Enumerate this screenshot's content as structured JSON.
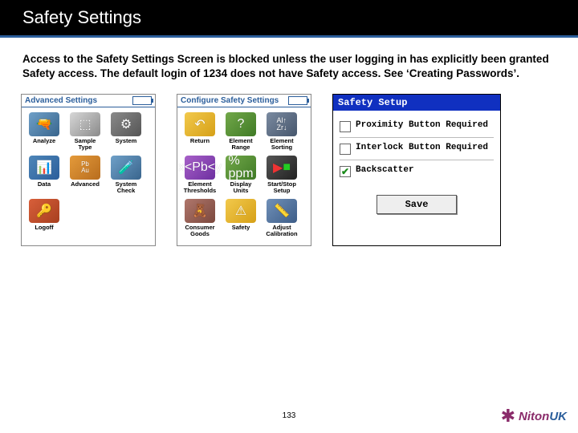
{
  "slide": {
    "title": "Safety Settings",
    "body": "Access to the Safety Settings Screen is blocked unless the user logging in has explicitly been granted Safety access. The default login of 1234 does not have Safety access. See ‘Creating Passwords’.",
    "page_number": "133"
  },
  "logo": {
    "brand_left": "Niton",
    "brand_right": "UK"
  },
  "panelA": {
    "title": "Advanced Settings",
    "items": [
      {
        "label": "Analyze"
      },
      {
        "label": "Sample\nType"
      },
      {
        "label": "System"
      },
      {
        "label": "Data"
      },
      {
        "label": "Advanced"
      },
      {
        "label": "System\nCheck"
      },
      {
        "label": "Logoff"
      }
    ]
  },
  "panelB": {
    "title": "Configure Safety Settings",
    "items": [
      {
        "label": "Return"
      },
      {
        "label": "Element\nRange"
      },
      {
        "label": "Element\nSorting"
      },
      {
        "label": "Element\nThresholds"
      },
      {
        "label": "Display\nUnits"
      },
      {
        "label": "Start/Stop\nSetup"
      },
      {
        "label": "Consumer\nGoods"
      },
      {
        "label": "Safety"
      },
      {
        "label": "Adjust\nCalibration"
      }
    ]
  },
  "dialog": {
    "title": "Safety Setup",
    "options": [
      {
        "label": "Proximity Button Required",
        "checked": false
      },
      {
        "label": "Interlock Button Required",
        "checked": false
      },
      {
        "label": "Backscatter",
        "checked": true
      }
    ],
    "save": "Save"
  }
}
